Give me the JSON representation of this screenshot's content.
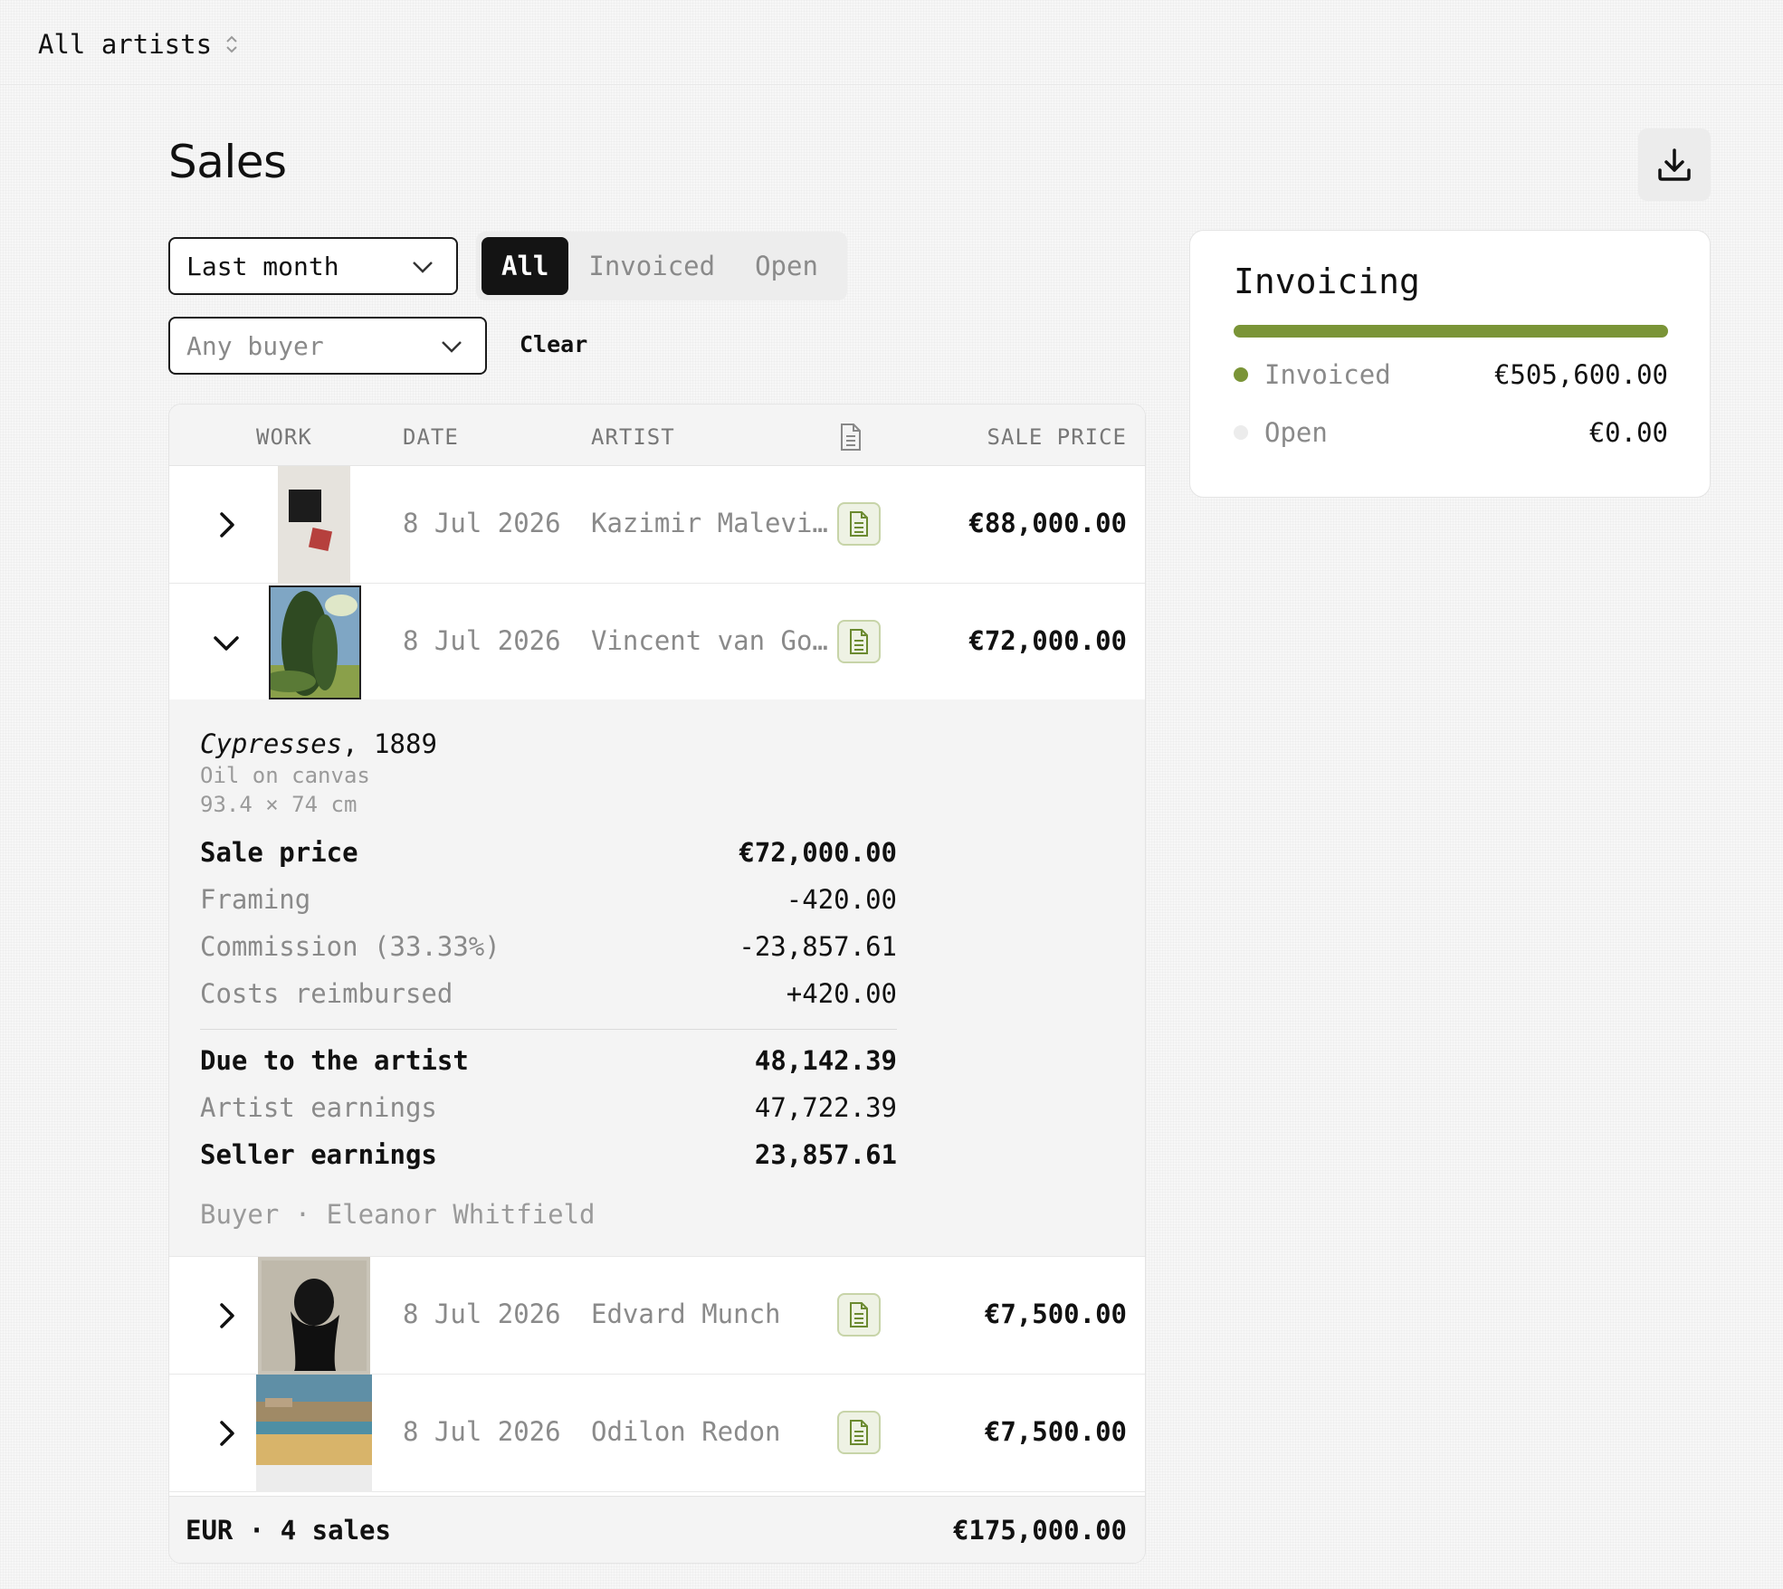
{
  "topbar": {
    "artist_filter": "All artists"
  },
  "page": {
    "title": "Sales"
  },
  "filters": {
    "period": "Last month",
    "buyer_placeholder": "Any buyer",
    "clear_label": "Clear",
    "status_tabs": [
      "All",
      "Invoiced",
      "Open"
    ],
    "active_status": "All"
  },
  "table": {
    "headers": {
      "work": "WORK",
      "date": "DATE",
      "artist": "ARTIST",
      "invoice": "document-icon",
      "price": "SALE PRICE"
    },
    "rows": [
      {
        "date": "8 Jul 2026",
        "artist": "Kazimir Malevi…",
        "price": "€88,000.00",
        "expanded": false
      },
      {
        "date": "8 Jul 2026",
        "artist": "Vincent van Go…",
        "price": "€72,000.00",
        "expanded": true
      },
      {
        "date": "8 Jul 2026",
        "artist": "Edvard Munch",
        "price": "€7,500.00",
        "expanded": false
      },
      {
        "date": "8 Jul 2026",
        "artist": "Odilon Redon",
        "price": "€7,500.00",
        "expanded": false
      }
    ],
    "detail": {
      "title": "Cypresses",
      "year": ", 1889",
      "medium": "Oil on canvas",
      "dimensions": "93.4 × 74 cm",
      "lines": [
        {
          "label": "Sale price",
          "amount": "€72,000.00"
        },
        {
          "label": "Framing",
          "amount": "-420.00"
        },
        {
          "label": "Commission (33.33%)",
          "amount": "-23,857.61"
        },
        {
          "label": "Costs reimbursed",
          "amount": "+420.00"
        }
      ],
      "totals": [
        {
          "label": "Due to the artist",
          "amount": "48,142.39"
        },
        {
          "label": "Artist earnings",
          "amount": "47,722.39"
        },
        {
          "label": "Seller earnings",
          "amount": "23,857.61"
        }
      ],
      "buyer": "Buyer · Eleanor Whitfield"
    },
    "footer": {
      "summary": "EUR · 4 sales",
      "total": "€175,000.00"
    }
  },
  "invoicing": {
    "title": "Invoicing",
    "invoiced_fraction": 1.0,
    "items": [
      {
        "label": "Invoiced",
        "amount": "€505,600.00",
        "color": "#7a9437"
      },
      {
        "label": "Open",
        "amount": "€0.00",
        "color": "#ececec"
      }
    ]
  },
  "colors": {
    "accent": "#7a9437",
    "badge_bg": "#eef2e4",
    "active_tab": "#141414"
  }
}
